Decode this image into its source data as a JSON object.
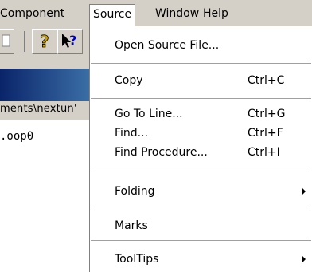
{
  "menubar": {
    "component": "Component",
    "source": "Source",
    "window": "Window",
    "help": "Help"
  },
  "toolbar": {
    "help_icon_glyph": "?",
    "whatsthis_icon_glyph": "↖?"
  },
  "path": {
    "text": "ments\\nextun'"
  },
  "editor": {
    "code_line": ".oop0"
  },
  "menu": {
    "open_source_file": "Open Source File...",
    "copy": "Copy",
    "copy_shortcut": "Ctrl+C",
    "go_to_line": "Go To Line...",
    "go_to_line_shortcut": "Ctrl+G",
    "find": "Find...",
    "find_shortcut": "Ctrl+F",
    "find_procedure": "Find Procedure...",
    "find_procedure_shortcut": "Ctrl+I",
    "folding": "Folding",
    "marks": "Marks",
    "tooltips": "ToolTips"
  }
}
